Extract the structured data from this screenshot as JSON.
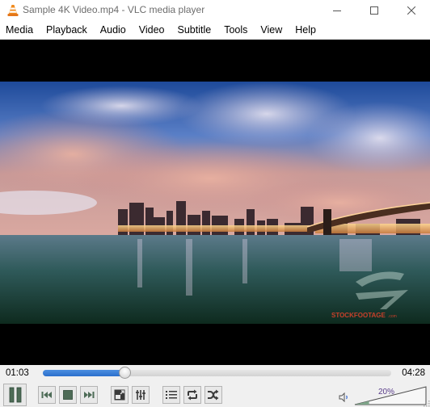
{
  "window": {
    "title": "Sample 4K Video.mp4 - VLC media player",
    "app_icon": "vlc-cone-icon",
    "controls": [
      "minimize-icon",
      "maximize-icon",
      "close-icon"
    ]
  },
  "menubar": {
    "items": [
      {
        "label": "Media"
      },
      {
        "label": "Playback"
      },
      {
        "label": "Audio"
      },
      {
        "label": "Video"
      },
      {
        "label": "Subtitle"
      },
      {
        "label": "Tools"
      },
      {
        "label": "View"
      },
      {
        "label": "Help"
      }
    ]
  },
  "video": {
    "watermark": "STOCKFOOTAGE",
    "watermark_suffix": ".com",
    "watermark_logo": "SF"
  },
  "playback": {
    "elapsed": "01:03",
    "total": "04:28",
    "progress_fraction": 0.235,
    "state": "playing"
  },
  "buttons": [
    {
      "name": "pause-button",
      "icon": "pause-icon"
    },
    {
      "name": "previous-button",
      "icon": "skip-previous-icon"
    },
    {
      "name": "stop-button",
      "icon": "stop-icon"
    },
    {
      "name": "next-button",
      "icon": "skip-next-icon"
    },
    {
      "name": "fullscreen-button",
      "icon": "fullscreen-icon"
    },
    {
      "name": "extended-settings-button",
      "icon": "equalizer-icon"
    },
    {
      "name": "playlist-button",
      "icon": "playlist-icon"
    },
    {
      "name": "loop-button",
      "icon": "loop-icon"
    },
    {
      "name": "shuffle-button",
      "icon": "shuffle-icon"
    }
  ],
  "volume": {
    "label": "20%",
    "level_percent": 20,
    "icon": "speaker-icon"
  },
  "colors": {
    "accent": "#2b6fcc",
    "icon_fill": "#4d6b56",
    "volume_fill": "#7fa68a"
  }
}
